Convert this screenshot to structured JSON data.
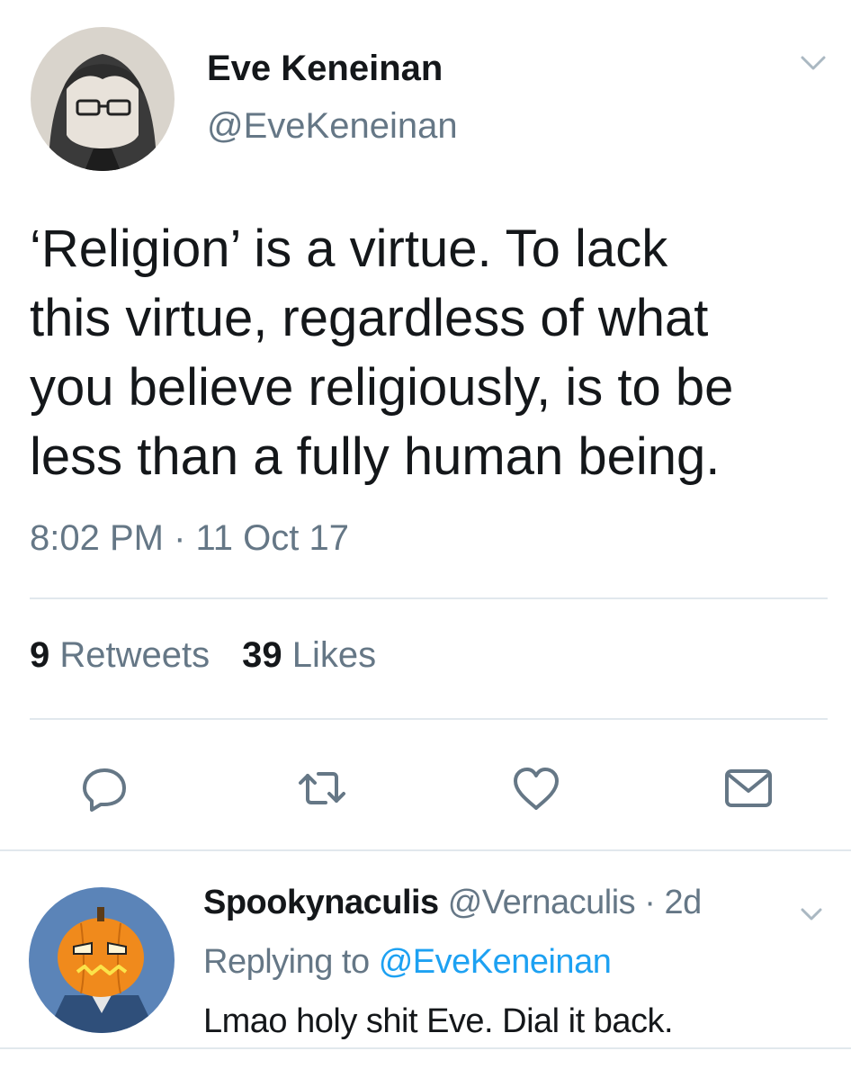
{
  "tweet": {
    "author_name": "Eve Keneinan",
    "author_handle": "@EveKeneinan",
    "text": "‘Religion’ is a virtue. To lack\nthis virtue, regardless of what\nyou believe religiously, is to be\nless than a fully human being.",
    "timestamp": "8:02 PM · 11 Oct 17",
    "retweets_count": "9",
    "retweets_label": "Retweets",
    "likes_count": "39",
    "likes_label": "Likes",
    "actions": [
      "reply-icon",
      "retweet-icon",
      "like-icon",
      "direct-message-icon"
    ]
  },
  "reply": {
    "author_name": "Spookynaculis",
    "author_handle": "@Vernaculis",
    "time": "· 2d",
    "replying_to_label": "Replying to",
    "replying_to_handle": "@EveKeneinan",
    "text": "Lmao holy shit Eve. Dial it back."
  },
  "colors": {
    "text": "#14171a",
    "secondary": "#657786",
    "link": "#1da1f2",
    "divider": "#e1e8ed"
  }
}
